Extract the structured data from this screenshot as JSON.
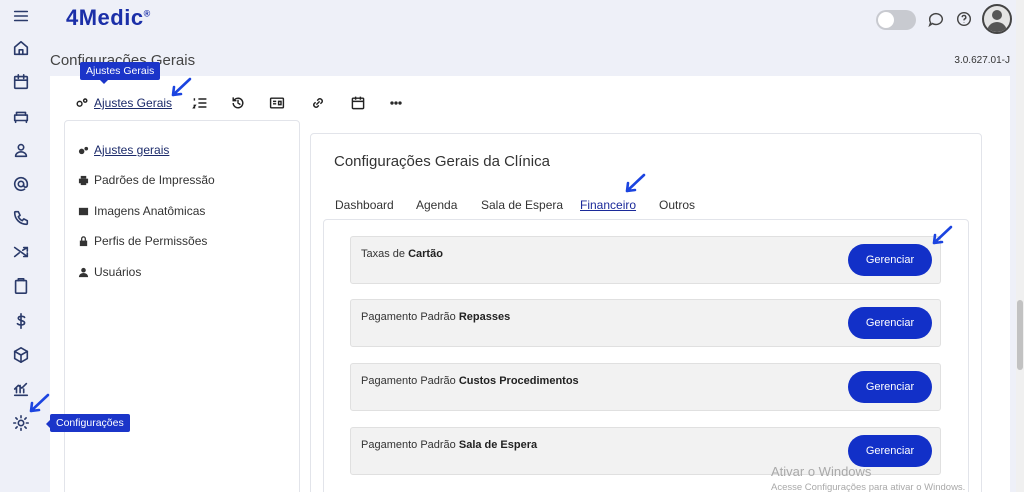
{
  "app": {
    "logo": "4Medic",
    "logo_mark": "®",
    "page_title": "Configurações Gerais",
    "version": "3.0.627.01-J"
  },
  "rail": {
    "items": [
      {
        "icon": "menu-icon"
      },
      {
        "icon": "home-icon"
      },
      {
        "icon": "calendar-icon"
      },
      {
        "icon": "waiting-room-icon"
      },
      {
        "icon": "patient-icon"
      },
      {
        "icon": "at-icon"
      },
      {
        "icon": "phone-icon"
      },
      {
        "icon": "shuffle-icon"
      },
      {
        "icon": "clipboard-icon"
      },
      {
        "icon": "dollar-icon"
      },
      {
        "icon": "box-icon"
      },
      {
        "icon": "chart-icon"
      },
      {
        "icon": "gear-icon"
      }
    ],
    "tooltip": "Configurações"
  },
  "toolbar": {
    "tooltip": "Ajustes Gerais",
    "ajustes_label": "Ajustes Gerais"
  },
  "menu": {
    "items": [
      {
        "label": "Ajustes gerais"
      },
      {
        "label": "Padrões de Impressão"
      },
      {
        "label": "Imagens Anatômicas"
      },
      {
        "label": "Perfis de Permissões"
      },
      {
        "label": "Usuários"
      }
    ]
  },
  "section": {
    "title": "Configurações Gerais da Clínica",
    "tabs": [
      {
        "label": "Dashboard"
      },
      {
        "label": "Agenda"
      },
      {
        "label": "Sala de Espera"
      },
      {
        "label": "Financeiro"
      },
      {
        "label": "Outros"
      }
    ],
    "active_tab": "Financeiro"
  },
  "rows": [
    {
      "prefix": "Taxas de",
      "bold": "Cartão",
      "button": "Gerenciar"
    },
    {
      "prefix": "Pagamento Padrão",
      "bold": "Repasses",
      "button": "Gerenciar"
    },
    {
      "prefix": "Pagamento Padrão",
      "bold": "Custos Procedimentos",
      "button": "Gerenciar"
    },
    {
      "prefix": "Pagamento Padrão",
      "bold": "Sala de Espera",
      "button": "Gerenciar"
    }
  ],
  "watermark": {
    "title": "Ativar o Windows",
    "subtitle": "Acesse Configurações para ativar o Windows."
  },
  "colors": {
    "brand": "#1b2fa8",
    "button": "#1230c8",
    "annotation": "#1b44e0"
  }
}
